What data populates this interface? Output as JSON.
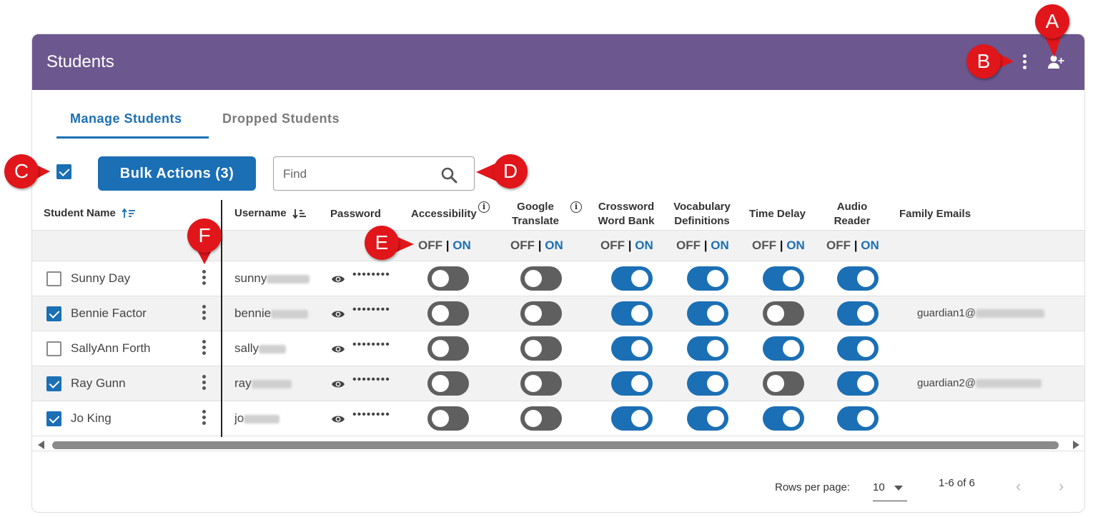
{
  "header": {
    "title": "Students",
    "more_icon": "kebab-vertical-icon",
    "add_icon": "add-user-icon"
  },
  "tabs": [
    {
      "label": "Manage Students",
      "active": true
    },
    {
      "label": "Dropped Students",
      "active": false
    }
  ],
  "toolbar": {
    "select_all_checked": true,
    "bulk_label": "Bulk Actions (3)",
    "search": {
      "placeholder": "Find",
      "value": ""
    }
  },
  "columns": {
    "student_name": "Student Name",
    "username": "Username",
    "password": "Password",
    "accessibility": "Accessibility",
    "google_translate_1": "Google",
    "google_translate_2": "Translate",
    "crossword_1": "Crossword",
    "crossword_2": "Word Bank",
    "vocab_1": "Vocabulary",
    "vocab_2": "Definitions",
    "time_delay": "Time Delay",
    "audio_1": "Audio",
    "audio_2": "Reader",
    "family_emails": "Family Emails"
  },
  "bulk_toggle": {
    "off": "OFF",
    "sep": "|",
    "on": "ON"
  },
  "rows": [
    {
      "name": "Sunny Day",
      "checked": false,
      "username": "sunny",
      "password": "••••••••",
      "email": "",
      "toggles": [
        false,
        false,
        true,
        true,
        true,
        true
      ]
    },
    {
      "name": "Bennie Factor",
      "checked": true,
      "username": "bennie",
      "password": "••••••••",
      "email": "guardian1@",
      "toggles": [
        false,
        false,
        true,
        true,
        false,
        true
      ]
    },
    {
      "name": "SallyAnn Forth",
      "checked": false,
      "username": "sally",
      "password": "••••••••",
      "email": "",
      "toggles": [
        false,
        false,
        true,
        true,
        true,
        true
      ]
    },
    {
      "name": "Ray Gunn",
      "checked": true,
      "username": "ray",
      "password": "••••••••",
      "email": "guardian2@",
      "toggles": [
        false,
        false,
        true,
        true,
        false,
        true
      ]
    },
    {
      "name": "Jo King",
      "checked": true,
      "username": "jo",
      "password": "••••••••",
      "email": "",
      "toggles": [
        false,
        false,
        true,
        true,
        true,
        true
      ]
    }
  ],
  "pagination": {
    "rows_per_page_label": "Rows per page:",
    "rows_per_page": "10",
    "range": "1-6 of 6"
  },
  "callouts": {
    "a": "A",
    "b": "B",
    "c": "C",
    "d": "D",
    "e": "E",
    "f": "F"
  },
  "colors": {
    "header": "#6c578e",
    "accent": "#1b6fb5",
    "callout": "#e0161b",
    "toggle_off": "#5f5f5f"
  }
}
